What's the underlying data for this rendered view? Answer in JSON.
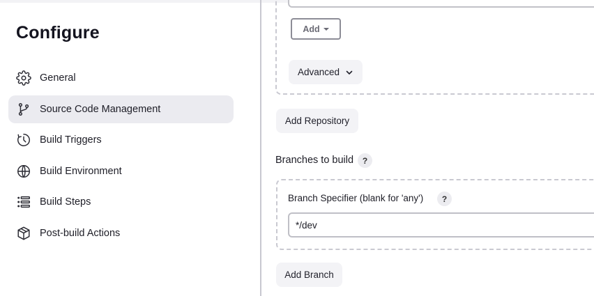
{
  "sidebar": {
    "title": "Configure",
    "items": [
      {
        "label": "General",
        "icon": "gear-icon"
      },
      {
        "label": "Source Code Management",
        "icon": "git-branch-icon",
        "active": true
      },
      {
        "label": "Build Triggers",
        "icon": "timer-icon"
      },
      {
        "label": "Build Environment",
        "icon": "globe-icon"
      },
      {
        "label": "Build Steps",
        "icon": "list-icon"
      },
      {
        "label": "Post-build Actions",
        "icon": "cube-icon"
      }
    ]
  },
  "main": {
    "add_label": "Add",
    "advanced_label": "Advanced",
    "add_repository_label": "Add Repository",
    "branches_label": "Branches to build",
    "help_glyph": "?",
    "branch_specifier_label": "Branch Specifier (blank for 'any')",
    "branch_specifier_value": "*/dev",
    "add_branch_label": "Add Branch"
  },
  "colors": {
    "active_bg": "#ebebf0",
    "button_bg": "#f3f3f6",
    "dashed_border": "#c9c9d1"
  }
}
